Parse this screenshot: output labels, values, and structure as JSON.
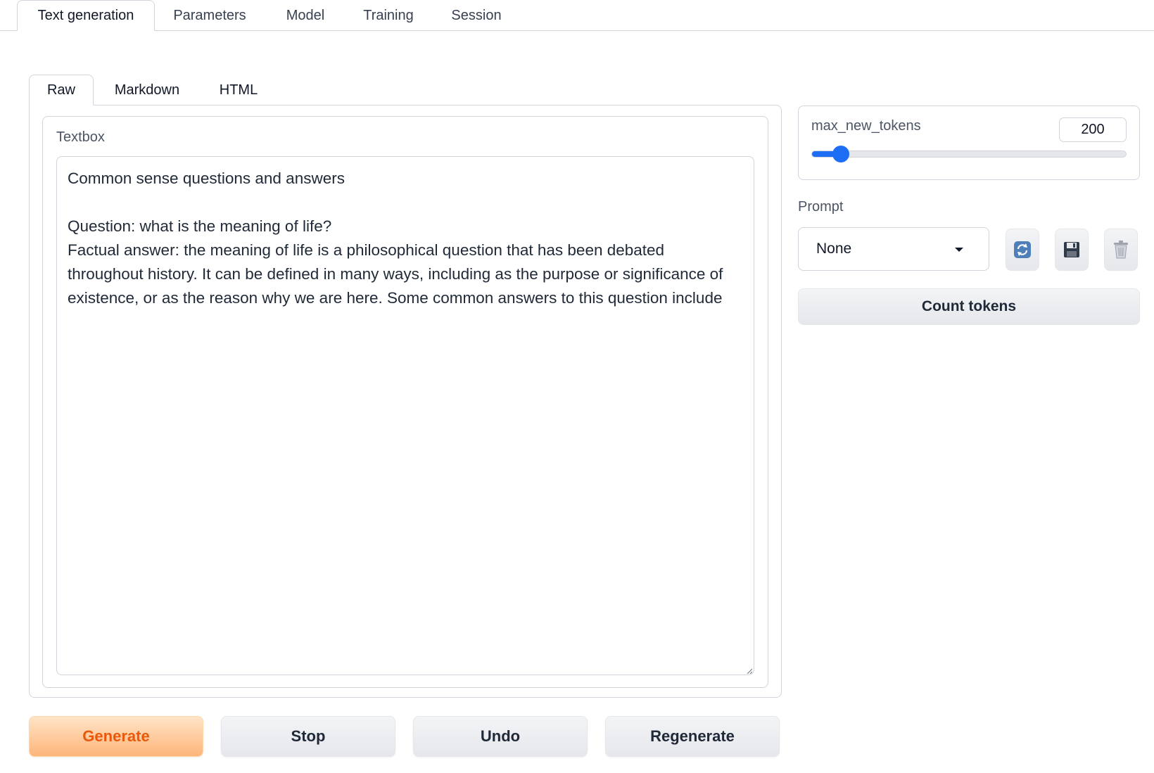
{
  "top_tabs": [
    "Text generation",
    "Parameters",
    "Model",
    "Training",
    "Session"
  ],
  "top_tabs_active": "Text generation",
  "inner_tabs": [
    "Raw",
    "Markdown",
    "HTML"
  ],
  "inner_tabs_active": "Raw",
  "textbox": {
    "label": "Textbox",
    "value": "Common sense questions and answers\n\nQuestion: what is the meaning of life?\nFactual answer: the meaning of life is a philosophical question that has been debated throughout history. It can be defined in many ways, including as the purpose or significance of existence, or as the reason why we are here. Some common answers to this question include"
  },
  "buttons": {
    "generate": "Generate",
    "stop": "Stop",
    "undo": "Undo",
    "regenerate": "Regenerate",
    "count_tokens": "Count tokens"
  },
  "max_new_tokens": {
    "label": "max_new_tokens",
    "value": "200",
    "slider_fraction": 0.07
  },
  "prompt": {
    "label": "Prompt",
    "selected": "None"
  },
  "icons": {
    "refresh": "refresh-icon",
    "save": "save-icon",
    "delete": "trash-icon"
  },
  "colors": {
    "accent": "#1d6ef5",
    "primary_text": "#ea580c",
    "primary_bg_top": "#ffe4c7",
    "primary_bg_bottom": "#fdb57a"
  }
}
